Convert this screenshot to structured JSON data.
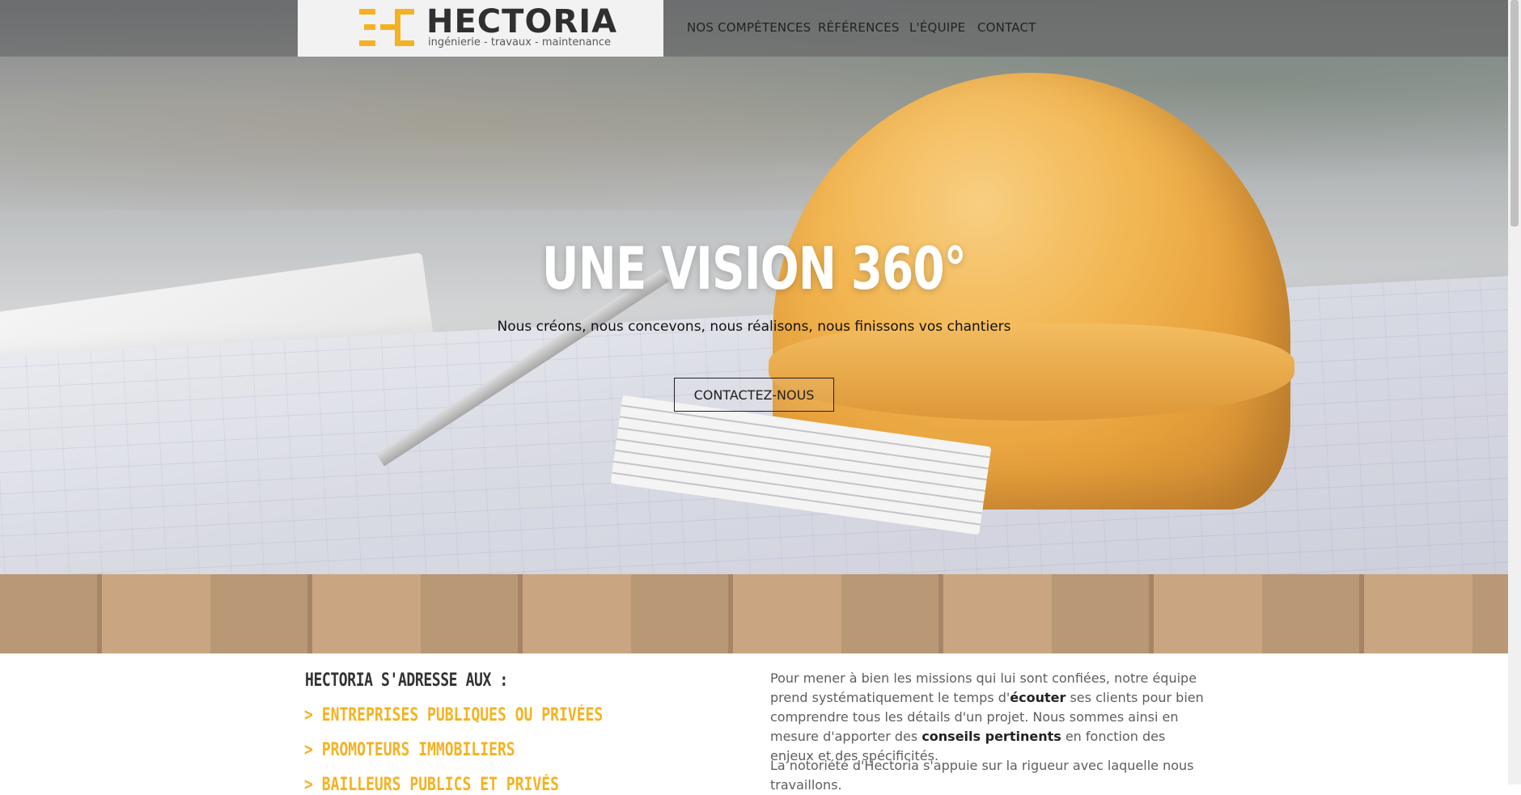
{
  "brand": {
    "name": "HECTORIA",
    "tagline": "ingénierie - travaux - maintenance",
    "accent_color": "#f4b223"
  },
  "nav": {
    "items": [
      {
        "label": "NOS COMPÉTENCES"
      },
      {
        "label": "RÉFÉRENCES"
      },
      {
        "label": "L'ÉQUIPE"
      },
      {
        "label": "CONTACT"
      }
    ]
  },
  "hero": {
    "title": "UNE VISION 360°",
    "subtitle": "Nous créons, nous concevons, nous réalisons, nous finissons vos chantiers",
    "cta_label": "CONTACTEZ-NOUS"
  },
  "audience": {
    "heading": "HECTORIA S'ADRESSE AUX :",
    "items": [
      "> ENTREPRISES PUBLIQUES OU PRIVÉES",
      "> PROMOTEURS IMMOBILIERS",
      "> BAILLEURS PUBLICS ET PRIVÉS"
    ]
  },
  "about": {
    "p1_a": "Pour mener à bien les missions qui lui sont confiées, notre équipe prend systématiquement le temps d'",
    "p1_b": "écouter",
    "p1_c": " ses clients pour bien comprendre tous les détails d'un projet. Nous sommes ainsi en mesure d'apporter des ",
    "p1_d": "conseils pertinents",
    "p1_e": " en fonction des enjeux et des spécificités.",
    "p2": "La notoriété d'Hectoria s'appuie sur la rigueur avec laquelle nous travaillons."
  }
}
